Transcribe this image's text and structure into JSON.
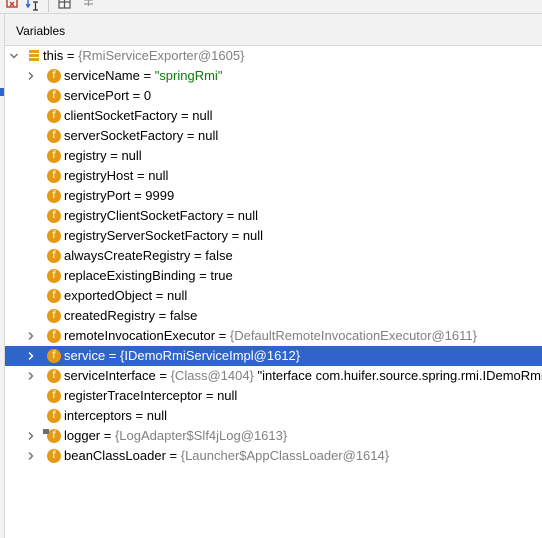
{
  "toolbar": {
    "icons": [
      "debug-icon",
      "step-icon",
      "table-icon",
      "settings-icon"
    ]
  },
  "panel": {
    "title": "Variables"
  },
  "root": {
    "name": "this",
    "eq": " = ",
    "ref": "{RmiServiceExporter@1605}"
  },
  "fields": [
    {
      "name": "serviceName",
      "eq": " = ",
      "value": "\"springRmi\"",
      "kind": "string",
      "expandable": true
    },
    {
      "name": "servicePort",
      "eq": " = ",
      "value": "0",
      "kind": "plain",
      "expandable": false
    },
    {
      "name": "clientSocketFactory",
      "eq": " = ",
      "value": "null",
      "kind": "plain",
      "expandable": false
    },
    {
      "name": "serverSocketFactory",
      "eq": " = ",
      "value": "null",
      "kind": "plain",
      "expandable": false
    },
    {
      "name": "registry",
      "eq": " = ",
      "value": "null",
      "kind": "plain",
      "expandable": false
    },
    {
      "name": "registryHost",
      "eq": " = ",
      "value": "null",
      "kind": "plain",
      "expandable": false
    },
    {
      "name": "registryPort",
      "eq": " = ",
      "value": "9999",
      "kind": "plain",
      "expandable": false
    },
    {
      "name": "registryClientSocketFactory",
      "eq": " = ",
      "value": "null",
      "kind": "plain",
      "expandable": false
    },
    {
      "name": "registryServerSocketFactory",
      "eq": " = ",
      "value": "null",
      "kind": "plain",
      "expandable": false
    },
    {
      "name": "alwaysCreateRegistry",
      "eq": " = ",
      "value": "false",
      "kind": "plain",
      "expandable": false
    },
    {
      "name": "replaceExistingBinding",
      "eq": " = ",
      "value": "true",
      "kind": "plain",
      "expandable": false
    },
    {
      "name": "exportedObject",
      "eq": " = ",
      "value": "null",
      "kind": "plain",
      "expandable": false
    },
    {
      "name": "createdRegistry",
      "eq": " = ",
      "value": "false",
      "kind": "plain",
      "expandable": false
    },
    {
      "name": "remoteInvocationExecutor",
      "eq": " = ",
      "value": "{DefaultRemoteInvocationExecutor@1611}",
      "kind": "ref",
      "expandable": true
    },
    {
      "name": "service",
      "eq": " = ",
      "value": "{IDemoRmiServiceImpl@1612}",
      "kind": "ref",
      "expandable": true,
      "selected": true
    },
    {
      "name": "serviceInterface",
      "eq": " = ",
      "value": "{Class@1404}",
      "kind": "ref",
      "extra": " \"interface com.huifer.source.spring.rmi.IDemoRmi",
      "expandable": true
    },
    {
      "name": "registerTraceInterceptor",
      "eq": " = ",
      "value": "null",
      "kind": "plain",
      "expandable": false
    },
    {
      "name": "interceptors",
      "eq": " = ",
      "value": "null",
      "kind": "plain",
      "expandable": false
    },
    {
      "name": "logger",
      "eq": " = ",
      "value": "{LogAdapter$Slf4jLog@1613}",
      "kind": "ref",
      "expandable": true,
      "badge": true
    },
    {
      "name": "beanClassLoader",
      "eq": " = ",
      "value": "{Launcher$AppClassLoader@1614}",
      "kind": "ref",
      "expandable": true
    }
  ],
  "colors": {
    "selection": "#2f65ca",
    "field_icon": "#e59a14",
    "string": "#0a7a0a",
    "ref": "#808080"
  }
}
